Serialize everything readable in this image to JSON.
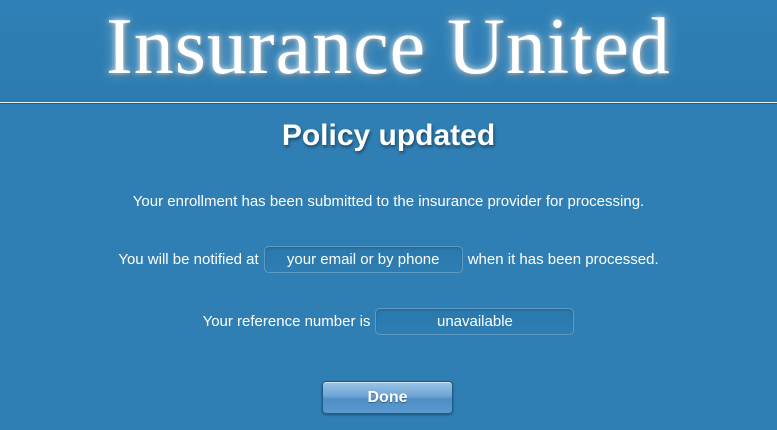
{
  "app": {
    "title": "Insurance United"
  },
  "page": {
    "title": "Policy updated",
    "message_submitted": "Your enrollment has been submitted to the insurance provider for processing.",
    "notify_prefix": "You will be notified at",
    "notify_value": "your email or by phone",
    "notify_suffix": "when it has been processed.",
    "reference_prefix": "Your reference number is",
    "reference_value": "unavailable"
  },
  "buttons": {
    "done_label": "Done"
  },
  "colors": {
    "background": "#2f7fb4",
    "button": "#6ea5d3"
  }
}
